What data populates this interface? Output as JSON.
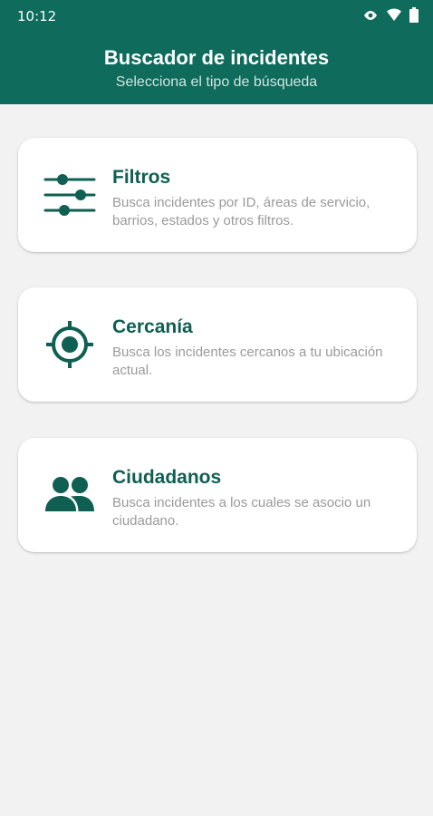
{
  "status_bar": {
    "time": "10:12",
    "icons": [
      "eye-icon",
      "wifi-icon",
      "battery-icon"
    ]
  },
  "header": {
    "title": "Buscador de incidentes",
    "subtitle": "Selecciona el tipo de búsqueda"
  },
  "options": [
    {
      "icon": "sliders-icon",
      "title": "Filtros",
      "description": "Busca incidentes por ID, áreas de servicio, barrios, estados y otros filtros."
    },
    {
      "icon": "location-target-icon",
      "title": "Cercanía",
      "description": "Busca los incidentes cercanos a tu ubicación actual."
    },
    {
      "icon": "people-icon",
      "title": "Ciudadanos",
      "description": "Busca incidentes a los cuales se asocio un ciudadano."
    }
  ],
  "colors": {
    "primary": "#0f6b5c",
    "title_text": "#0f5f52",
    "description_text": "#9a9a9a",
    "background": "#f2f2f2"
  }
}
